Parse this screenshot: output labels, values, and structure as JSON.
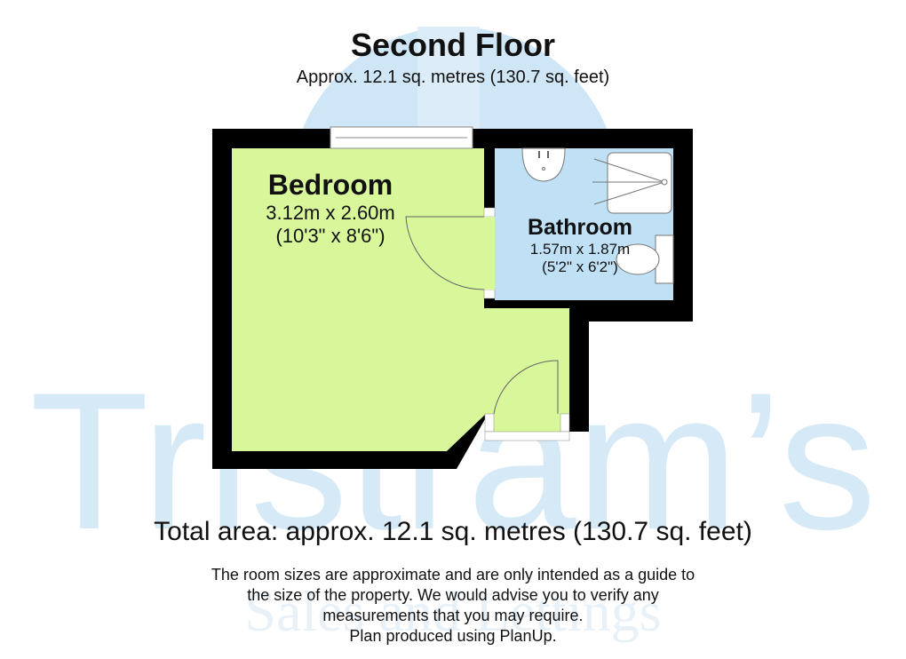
{
  "header": {
    "title": "Second Floor",
    "subtitle": "Approx. 12.1 sq. metres (130.7 sq. feet)"
  },
  "rooms": [
    {
      "name": "Bedroom",
      "dim_metric": "3.12m x 2.60m",
      "dim_imperial": "(10'3\" x 8'6\")",
      "color": "#d8f79a"
    },
    {
      "name": "Bathroom",
      "dim_metric": "1.57m x 1.87m",
      "dim_imperial": "(5'2\" x 6'2\")",
      "color": "#bfe0f5"
    }
  ],
  "footer": {
    "total": "Total area: approx. 12.1 sq. metres (130.7 sq. feet)",
    "disclaimer": [
      "The room sizes are approximate and are only intended as a guide to",
      "the size of the property. We would advise you to verify any",
      "measurements that you may require.",
      "Plan produced using PlanUp."
    ]
  },
  "watermark": {
    "brand": "Tristram’s",
    "tagline": "Sales and Lettings",
    "color": "#d6e9f6"
  },
  "colors": {
    "wall": "#000000"
  }
}
